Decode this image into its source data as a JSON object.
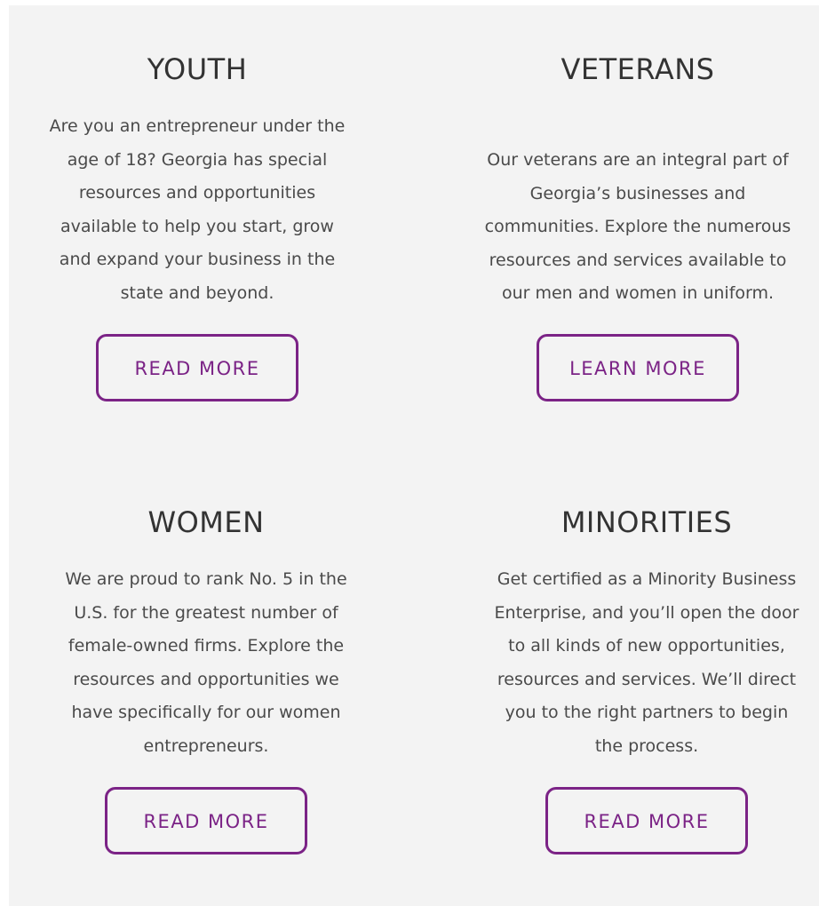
{
  "cards": [
    {
      "title": "YOUTH",
      "lines": [
        "Are you an entrepreneur under the",
        "age of 18? Georgia has special",
        "resources and opportunities",
        "available to help you start, grow",
        "and expand your business in the",
        "state and beyond."
      ],
      "button": "READ MORE"
    },
    {
      "title": "VETERANS",
      "lines": [
        "Our veterans are an integral part of",
        "Georgia’s businesses and",
        "communities. Explore the numerous",
        "resources and services available to",
        "our men and women in uniform."
      ],
      "button": "LEARN MORE"
    },
    {
      "title": "WOMEN",
      "lines": [
        "We are proud to rank No. 5 in the",
        "U.S. for the greatest number of",
        "female-owned firms. Explore the",
        "resources and opportunities we",
        "have specifically for our women",
        "entrepreneurs."
      ],
      "button": "READ MORE"
    },
    {
      "title": "MINORITIES",
      "lines": [
        "Get certified as a Minority Business",
        "Enterprise, and you’ll open the door",
        "to all kinds of new opportunities,",
        "resources and services. We’ll direct",
        "you to the right partners to begin",
        "the process."
      ],
      "button": "READ MORE"
    }
  ]
}
